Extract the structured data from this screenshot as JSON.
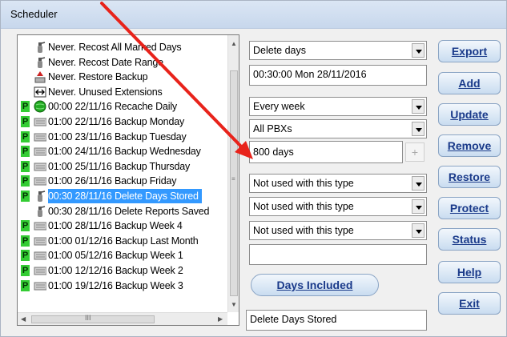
{
  "window": {
    "title": "Scheduler"
  },
  "schedule_list": {
    "items": [
      {
        "badge": "",
        "icon": "fire-extinguisher-icon",
        "text": "Never.  Recost All Marked Days",
        "selected": false
      },
      {
        "badge": "",
        "icon": "fire-extinguisher-icon",
        "text": "Never.  Recost Date Range",
        "selected": false
      },
      {
        "badge": "",
        "icon": "restore-backup-icon",
        "text": "Never.  Restore Backup",
        "selected": false
      },
      {
        "badge": "",
        "icon": "extensions-icon",
        "text": "Never.  Unused Extensions",
        "selected": false
      },
      {
        "badge": "P",
        "icon": "green-globe-icon",
        "text": "00:00 22/11/16 Recache Daily",
        "selected": false
      },
      {
        "badge": "P",
        "icon": "tape-drive-icon",
        "text": "01:00 22/11/16 Backup Monday",
        "selected": false
      },
      {
        "badge": "P",
        "icon": "tape-drive-icon",
        "text": "01:00 23/11/16 Backup Tuesday",
        "selected": false
      },
      {
        "badge": "P",
        "icon": "tape-drive-icon",
        "text": "01:00 24/11/16 Backup Wednesday",
        "selected": false
      },
      {
        "badge": "P",
        "icon": "tape-drive-icon",
        "text": "01:00 25/11/16 Backup Thursday",
        "selected": false
      },
      {
        "badge": "P",
        "icon": "tape-drive-icon",
        "text": "01:00 26/11/16 Backup Friday",
        "selected": false
      },
      {
        "badge": "P",
        "icon": "fire-extinguisher-icon",
        "text": "00:30 28/11/16 Delete Days Stored",
        "selected": true
      },
      {
        "badge": "",
        "icon": "fire-extinguisher-icon",
        "text": "00:30 28/11/16 Delete Reports Saved",
        "selected": false
      },
      {
        "badge": "P",
        "icon": "tape-drive-icon",
        "text": "01:00 28/11/16 Backup Week 4",
        "selected": false
      },
      {
        "badge": "P",
        "icon": "tape-drive-icon",
        "text": "01:00 01/12/16 Backup Last Month",
        "selected": false
      },
      {
        "badge": "P",
        "icon": "tape-drive-icon",
        "text": "01:00 05/12/16 Backup Week 1",
        "selected": false
      },
      {
        "badge": "P",
        "icon": "tape-drive-icon",
        "text": "01:00 12/12/16 Backup Week 2",
        "selected": false
      },
      {
        "badge": "P",
        "icon": "tape-drive-icon",
        "text": "01:00 19/12/16 Backup Week 3",
        "selected": false
      }
    ],
    "hscroll_thumb_glyph": "III"
  },
  "form": {
    "task_type": "Delete days",
    "start_datetime": "00:30:00 Mon 28/11/2016",
    "frequency": "Every week",
    "pbx_scope": "All PBXs",
    "days_value": "800 days",
    "plus_label": "+",
    "option1": "Not used with this type",
    "option2": "Not used with this type",
    "option3": "Not used with this type",
    "blank_field": "",
    "days_included_label": "Days Included",
    "description": "Delete Days Stored"
  },
  "buttons": {
    "export": "Export",
    "add": "Add",
    "update": "Update",
    "remove": "Remove",
    "restore": "Restore",
    "protect": "Protect",
    "status": "Status",
    "help": "Help",
    "exit": "Exit"
  },
  "annotation": {
    "color": "#e8231b"
  }
}
